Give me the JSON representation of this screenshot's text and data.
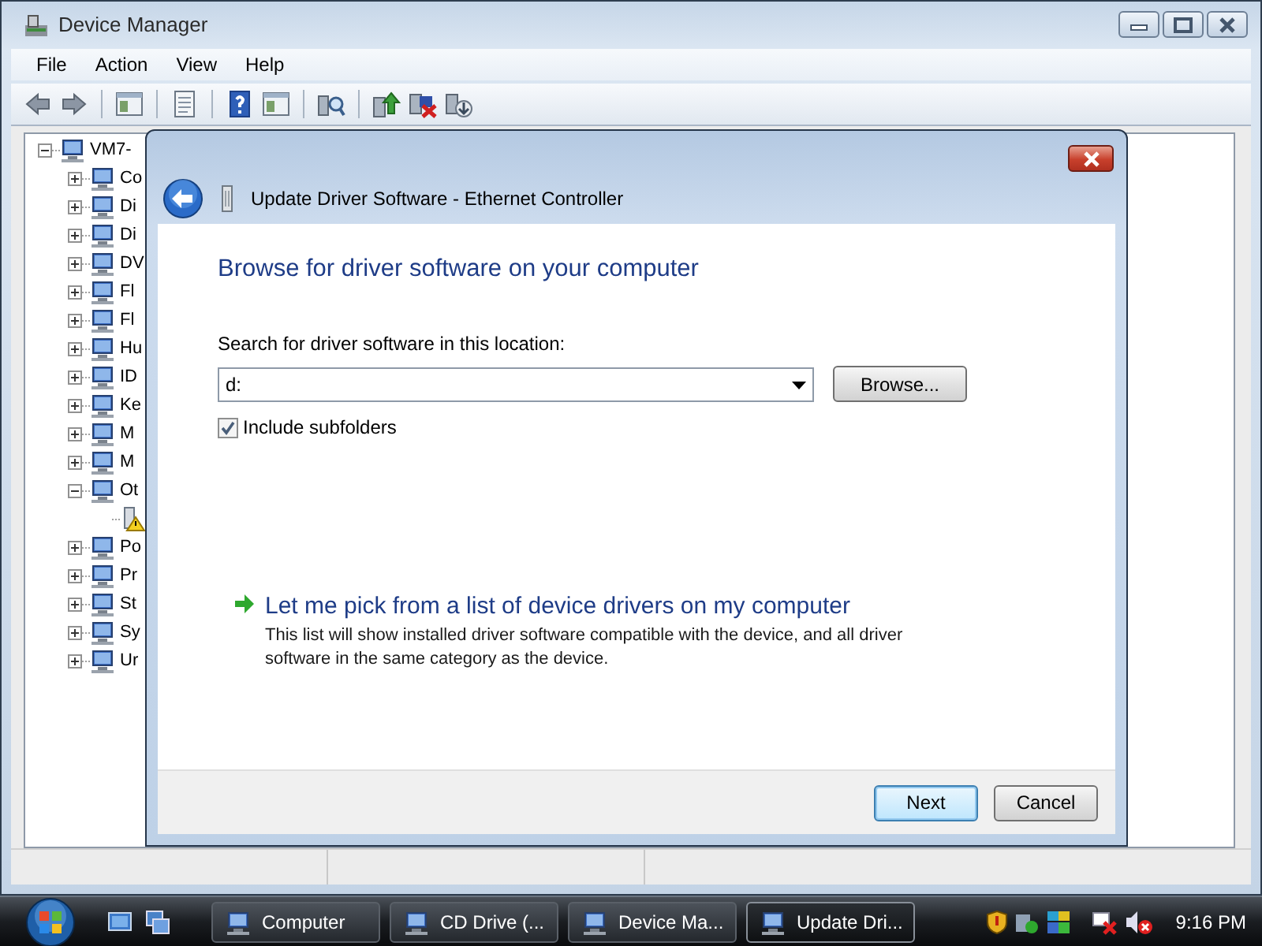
{
  "window": {
    "title": "Device Manager"
  },
  "menu": [
    "File",
    "Action",
    "View",
    "Help"
  ],
  "tree": {
    "label": "VM7-",
    "expanded": true,
    "children": [
      {
        "label": "Co",
        "expanded": false
      },
      {
        "label": "Di",
        "expanded": false
      },
      {
        "label": "Di",
        "expanded": false
      },
      {
        "label": "DV",
        "expanded": false
      },
      {
        "label": "Fl",
        "expanded": false
      },
      {
        "label": "Fl",
        "expanded": false
      },
      {
        "label": "Hu",
        "expanded": false
      },
      {
        "label": "ID",
        "expanded": false
      },
      {
        "label": "Ke",
        "expanded": false
      },
      {
        "label": "M",
        "expanded": false
      },
      {
        "label": "M",
        "expanded": false
      },
      {
        "label": "Ot",
        "expanded": true,
        "children": [
          {
            "warning": true
          }
        ]
      },
      {
        "label": "Po",
        "expanded": false
      },
      {
        "label": "Pr",
        "expanded": false
      },
      {
        "label": "St",
        "expanded": false
      },
      {
        "label": "Sy",
        "expanded": false
      },
      {
        "label": "Ur",
        "expanded": false
      }
    ]
  },
  "dialog": {
    "title": "Update Driver Software - Ethernet Controller",
    "heading": "Browse for driver software on your computer",
    "search_label": "Search for driver software in this location:",
    "location": {
      "value": "d:"
    },
    "browse_button": "Browse...",
    "include_subfolders": {
      "label": "Include subfolders",
      "checked": true
    },
    "pick_option": {
      "title": "Let me pick from a list of device drivers on my computer",
      "description": "This list will show installed driver software compatible with the device, and all driver software in the same category as the device."
    },
    "buttons": [
      {
        "label": "Next",
        "default": true
      },
      {
        "label": "Cancel",
        "default": false
      }
    ]
  },
  "taskbar": {
    "buttons": [
      {
        "label": "Computer",
        "selected": false
      },
      {
        "label": "CD Drive (...",
        "selected": false
      },
      {
        "label": "Device Ma...",
        "selected": false
      },
      {
        "label": "Update Dri...",
        "selected": true
      }
    ],
    "clock": "9:16 PM"
  }
}
